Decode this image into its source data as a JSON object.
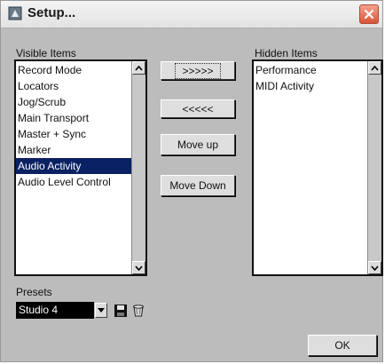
{
  "window": {
    "title": "Setup..."
  },
  "visible_items": {
    "label": "Visible Items",
    "items": [
      "Record Mode",
      "Locators",
      "Jog/Scrub",
      "Main Transport",
      "Master + Sync",
      "Marker",
      "Audio Activity",
      "Audio Level Control"
    ],
    "selected": "Audio Activity"
  },
  "hidden_items": {
    "label": "Hidden Items",
    "items": [
      "Performance",
      "MIDI Activity"
    ]
  },
  "buttons": {
    "move_right": ">>>>>",
    "move_left": "<<<<<",
    "move_up": "Move up",
    "move_down": "Move Down",
    "ok": "OK"
  },
  "presets": {
    "label": "Presets",
    "selected": "Studio 4"
  },
  "icons": {
    "title": "window-app-icon",
    "close": "close-icon",
    "save": "save-icon",
    "delete": "delete-icon"
  },
  "colors": {
    "dialog_bg": "#bcbcbc",
    "selection_bg": "#0a2263",
    "close_button": "#d9543a"
  }
}
